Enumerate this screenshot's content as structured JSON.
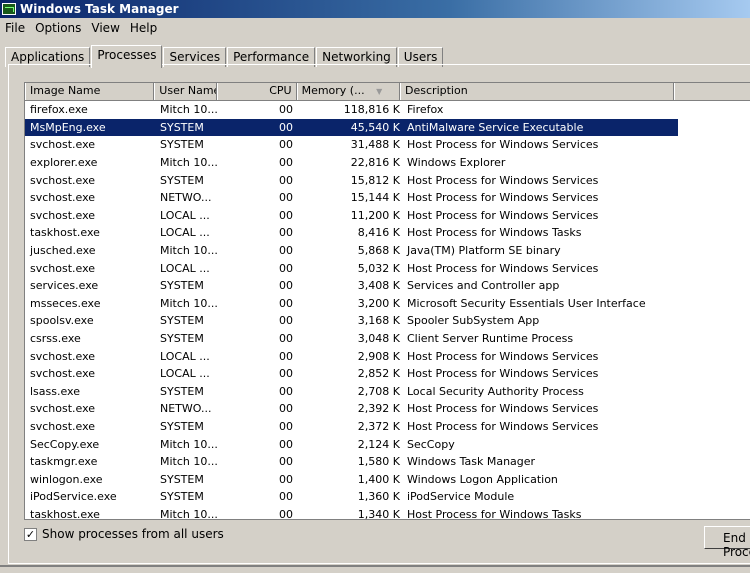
{
  "window": {
    "title": "Windows Task Manager"
  },
  "menu": [
    "File",
    "Options",
    "View",
    "Help"
  ],
  "tabs": [
    {
      "label": "Applications"
    },
    {
      "label": "Processes",
      "active": true
    },
    {
      "label": "Services"
    },
    {
      "label": "Performance"
    },
    {
      "label": "Networking"
    },
    {
      "label": "Users"
    }
  ],
  "columns": [
    "Image Name",
    "User Name",
    "CPU",
    "Memory (...",
    "Description"
  ],
  "sort_indicator": "▼",
  "selected_color": "#0a246a",
  "rows": [
    [
      "firefox.exe",
      "Mitch 10...",
      "00",
      "118,816 K",
      "Firefox"
    ],
    [
      "MsMpEng.exe",
      "SYSTEM",
      "00",
      "45,540 K",
      "AntiMalware Service Executable"
    ],
    [
      "svchost.exe",
      "SYSTEM",
      "00",
      "31,488 K",
      "Host Process for Windows Services"
    ],
    [
      "explorer.exe",
      "Mitch 10...",
      "00",
      "22,816 K",
      "Windows Explorer"
    ],
    [
      "svchost.exe",
      "SYSTEM",
      "00",
      "15,812 K",
      "Host Process for Windows Services"
    ],
    [
      "svchost.exe",
      "NETWO...",
      "00",
      "15,144 K",
      "Host Process for Windows Services"
    ],
    [
      "svchost.exe",
      "LOCAL ...",
      "00",
      "11,200 K",
      "Host Process for Windows Services"
    ],
    [
      "taskhost.exe",
      "LOCAL ...",
      "00",
      "8,416 K",
      "Host Process for Windows Tasks"
    ],
    [
      "jusched.exe",
      "Mitch 10...",
      "00",
      "5,868 K",
      "Java(TM) Platform SE binary"
    ],
    [
      "svchost.exe",
      "LOCAL ...",
      "00",
      "5,032 K",
      "Host Process for Windows Services"
    ],
    [
      "services.exe",
      "SYSTEM",
      "00",
      "3,408 K",
      "Services and Controller app"
    ],
    [
      "msseces.exe",
      "Mitch 10...",
      "00",
      "3,200 K",
      "Microsoft Security Essentials User Interface"
    ],
    [
      "spoolsv.exe",
      "SYSTEM",
      "00",
      "3,168 K",
      "Spooler SubSystem App"
    ],
    [
      "csrss.exe",
      "SYSTEM",
      "00",
      "3,048 K",
      "Client Server Runtime Process"
    ],
    [
      "svchost.exe",
      "LOCAL ...",
      "00",
      "2,908 K",
      "Host Process for Windows Services"
    ],
    [
      "svchost.exe",
      "LOCAL ...",
      "00",
      "2,852 K",
      "Host Process for Windows Services"
    ],
    [
      "lsass.exe",
      "SYSTEM",
      "00",
      "2,708 K",
      "Local Security Authority Process"
    ],
    [
      "svchost.exe",
      "NETWO...",
      "00",
      "2,392 K",
      "Host Process for Windows Services"
    ],
    [
      "svchost.exe",
      "SYSTEM",
      "00",
      "2,372 K",
      "Host Process for Windows Services"
    ],
    [
      "SecCopy.exe",
      "Mitch 10...",
      "00",
      "2,124 K",
      "SecCopy"
    ],
    [
      "taskmgr.exe",
      "Mitch 10...",
      "00",
      "1,580 K",
      "Windows Task Manager"
    ],
    [
      "winlogon.exe",
      "SYSTEM",
      "00",
      "1,400 K",
      "Windows Logon Application"
    ],
    [
      "iPodService.exe",
      "SYSTEM",
      "00",
      "1,360 K",
      "iPodService Module"
    ],
    [
      "taskhost.exe",
      "Mitch 10...",
      "00",
      "1,340 K",
      "Host Process for Windows Tasks"
    ]
  ],
  "selected_row": 1,
  "show_all": {
    "label": "Show processes from all users",
    "checked": true
  },
  "end_button": "End Process"
}
